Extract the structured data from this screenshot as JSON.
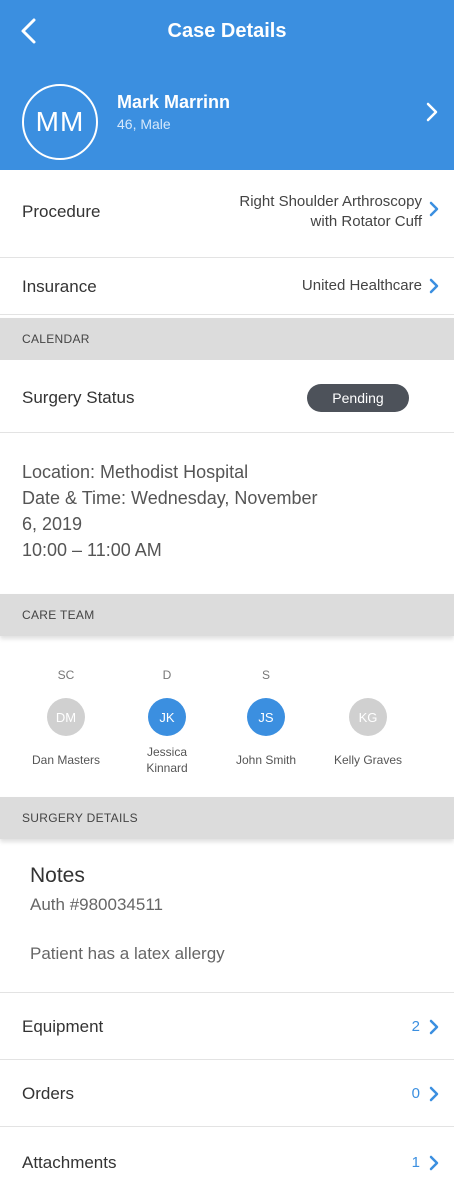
{
  "header": {
    "title": "Case Details",
    "color": "#3b8fe0",
    "patient": {
      "initials": "MM",
      "name": "Mark Marrinn",
      "meta": "46, Male"
    }
  },
  "procedure": {
    "label": "Procedure",
    "value_line1": "Right Shoulder Arthroscopy",
    "value_line2": "with Rotator Cuff"
  },
  "insurance": {
    "label": "Insurance",
    "value": "United Healthcare"
  },
  "calendar": {
    "section": "CALENDAR",
    "status_label": "Surgery Status",
    "status_value": "Pending",
    "location": "Location:  Methodist Hospital",
    "datetime_line1": "Date & Time:  Wednesday, November",
    "datetime_line2": "6, 2019",
    "time": "10:00 – 11:00 AM"
  },
  "care_team": {
    "section": "CARE TEAM",
    "members": [
      {
        "role": "SC",
        "initials": "DM",
        "name_line1": "Dan Masters",
        "name_line2": "",
        "active": false
      },
      {
        "role": "D",
        "initials": "JK",
        "name_line1": "Jessica",
        "name_line2": "Kinnard",
        "active": true
      },
      {
        "role": "S",
        "initials": "JS",
        "name_line1": "John Smith",
        "name_line2": "",
        "active": true
      },
      {
        "role": "",
        "initials": "KG",
        "name_line1": "Kelly Graves",
        "name_line2": "",
        "active": false
      }
    ]
  },
  "surgery_details": {
    "section": "SURGERY DETAILS",
    "notes_title": "Notes",
    "auth": "Auth #980034511",
    "note": "Patient has a latex allergy",
    "items": [
      {
        "label": "Equipment",
        "count": "2"
      },
      {
        "label": "Orders",
        "count": "0"
      },
      {
        "label": "Attachments",
        "count": "1"
      }
    ]
  },
  "colors": {
    "accent": "#3b8fe0",
    "inactive_avatar": "#d0d0d0",
    "pill": "#4d525a",
    "section_bg": "#dcdcdc"
  },
  "icons": {
    "back": "chevron-left-icon",
    "forward": "chevron-right-icon"
  }
}
